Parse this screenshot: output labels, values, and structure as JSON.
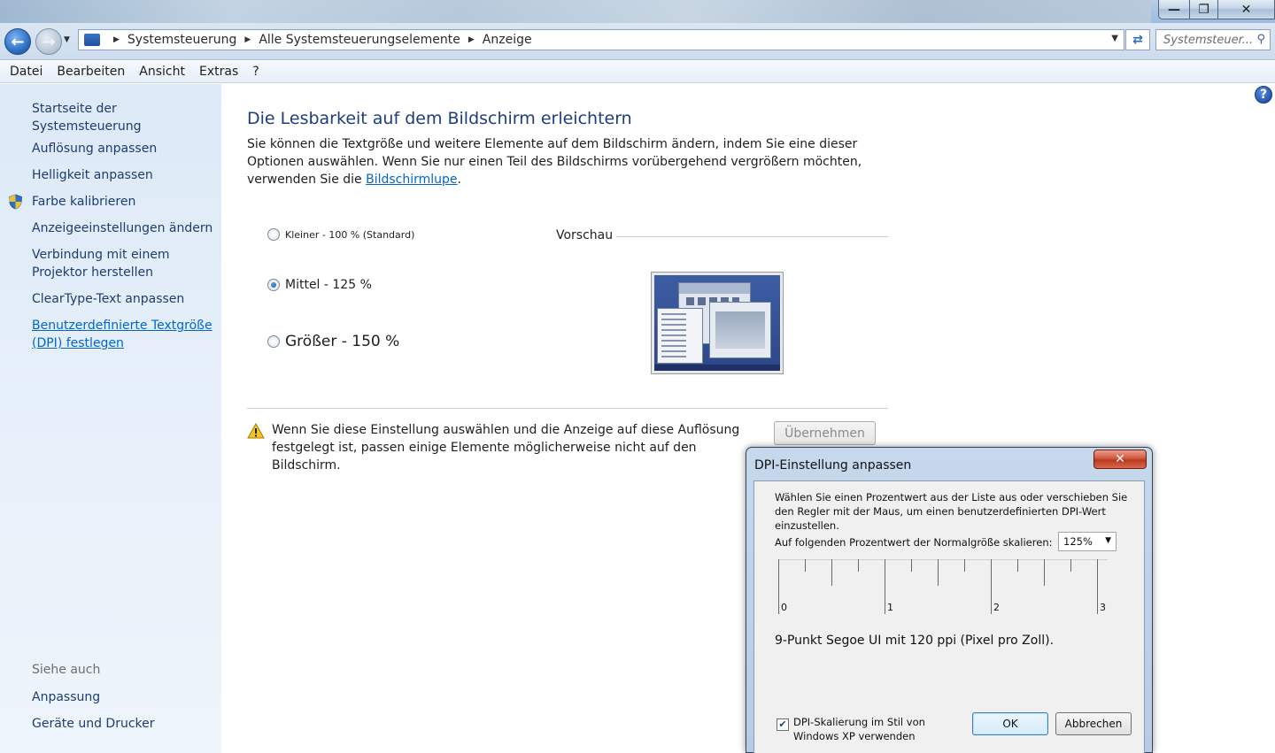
{
  "window": {
    "min_glyph": "—",
    "max_glyph": "❐",
    "close_glyph": "✕"
  },
  "address": {
    "crumbs": [
      "Systemsteuerung",
      "Alle Systemsteuerungselemente",
      "Anzeige"
    ],
    "search_placeholder": "Systemsteuer..."
  },
  "menu": [
    "Datei",
    "Bearbeiten",
    "Ansicht",
    "Extras",
    "?"
  ],
  "sidebar": {
    "items": [
      "Startseite der Systemsteuerung",
      "Auflösung anpassen",
      "Helligkeit anpassen",
      "Farbe kalibrieren",
      "Anzeigeeinstellungen ändern",
      "Verbindung mit einem Projektor herstellen",
      "ClearType-Text anpassen",
      "Benutzerdefinierte Textgröße (DPI) festlegen"
    ],
    "see_also_heading": "Siehe auch",
    "see_also": [
      "Anpassung",
      "Geräte und Drucker"
    ]
  },
  "main": {
    "title": "Die Lesbarkeit auf dem Bildschirm erleichtern",
    "intro": "Sie können die Textgröße und weitere Elemente auf dem Bildschirm ändern, indem Sie eine dieser Optionen auswählen. Wenn Sie nur einen Teil des Bildschirms vorübergehend vergrößern möchten, verwenden Sie die",
    "intro_link": "Bildschirmlupe",
    "intro_end": ".",
    "options": [
      {
        "label": "Kleiner - 100 % (Standard)",
        "checked": false
      },
      {
        "label": "Mittel - 125 %",
        "checked": true
      },
      {
        "label": "Größer - 150 %",
        "checked": false
      }
    ],
    "preview_label": "Vorschau",
    "warning": "Wenn Sie diese Einstellung auswählen und die Anzeige auf diese Auflösung festgelegt ist, passen einige Elemente möglicherweise nicht auf den Bildschirm.",
    "apply_label": "Übernehmen"
  },
  "dialog": {
    "title": "DPI-Einstellung anpassen",
    "description": "Wählen Sie einen Prozentwert aus der Liste aus oder verschieben Sie den Regler mit der Maus, um einen benutzerdefinierten DPI-Wert einzustellen.",
    "scale_label": "Auf folgenden Prozentwert der Normalgröße skalieren:",
    "scale_value": "125%",
    "ruler_labels": [
      "0",
      "1",
      "2",
      "3"
    ],
    "info": "9-Punkt Segoe UI mit 120 ppi (Pixel pro Zoll).",
    "xp_checkbox_label": "DPI-Skalierung im Stil von Windows XP verwenden",
    "xp_checked": true,
    "ok_label": "OK",
    "cancel_label": "Abbrechen"
  }
}
